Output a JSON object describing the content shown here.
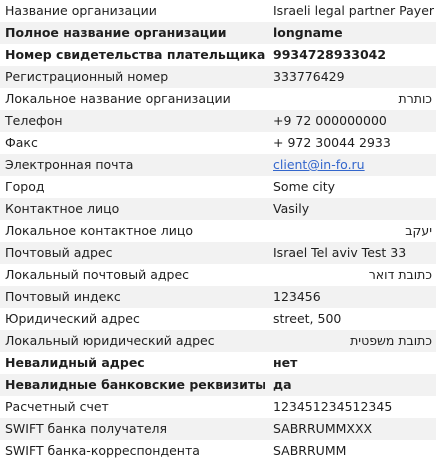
{
  "rows": [
    {
      "label": "Название организации",
      "value": "Israeli legal partner Payer",
      "bold": false,
      "link": false
    },
    {
      "label": "Полное название организации",
      "value": "longname",
      "bold": true,
      "link": false
    },
    {
      "label": "Номер свидетельства плательщика НДС",
      "value": "9934728933042",
      "bold": true,
      "link": false
    },
    {
      "label": "Регистрационный номер",
      "value": "333776429",
      "bold": false,
      "link": false
    },
    {
      "label": "Локальное название организации",
      "value": "כותרת",
      "bold": false,
      "link": false
    },
    {
      "label": "Телефон",
      "value": "+9 72 000000000",
      "bold": false,
      "link": false
    },
    {
      "label": "Факс",
      "value": "+ 972 30044 2933",
      "bold": false,
      "link": false
    },
    {
      "label": "Электронная почта",
      "value": "client@in-fo.ru",
      "bold": false,
      "link": true
    },
    {
      "label": "Город",
      "value": "Some city",
      "bold": false,
      "link": false
    },
    {
      "label": "Контактное лицо",
      "value": "Vasily",
      "bold": false,
      "link": false
    },
    {
      "label": "Локальное контактное лицо",
      "value": "יעקב",
      "bold": false,
      "link": false
    },
    {
      "label": "Почтовый адрес",
      "value": "Israel Tel aviv Test 33",
      "bold": false,
      "link": false
    },
    {
      "label": "Локальный почтовый адрес",
      "value": "כתובת דואר",
      "bold": false,
      "link": false
    },
    {
      "label": "Почтовый индекс",
      "value": "123456",
      "bold": false,
      "link": false
    },
    {
      "label": "Юридический адрес",
      "value": "street, 500",
      "bold": false,
      "link": false
    },
    {
      "label": "Локальный юридический адрес",
      "value": "כתובת משפטית",
      "bold": false,
      "link": false
    },
    {
      "label": "Невалидный адрес",
      "value": "нет",
      "bold": true,
      "link": false
    },
    {
      "label": "Невалидные банковские реквизиты",
      "value": "да",
      "bold": true,
      "link": false
    },
    {
      "label": "Расчетный счет",
      "value": "123451234512345",
      "bold": false,
      "link": false
    },
    {
      "label": "SWIFT банка получателя",
      "value": "SABRRUMMXXX",
      "bold": false,
      "link": false
    },
    {
      "label": "SWIFT банка-корреспондента",
      "value": "SABRRUMM",
      "bold": false,
      "link": false
    }
  ]
}
